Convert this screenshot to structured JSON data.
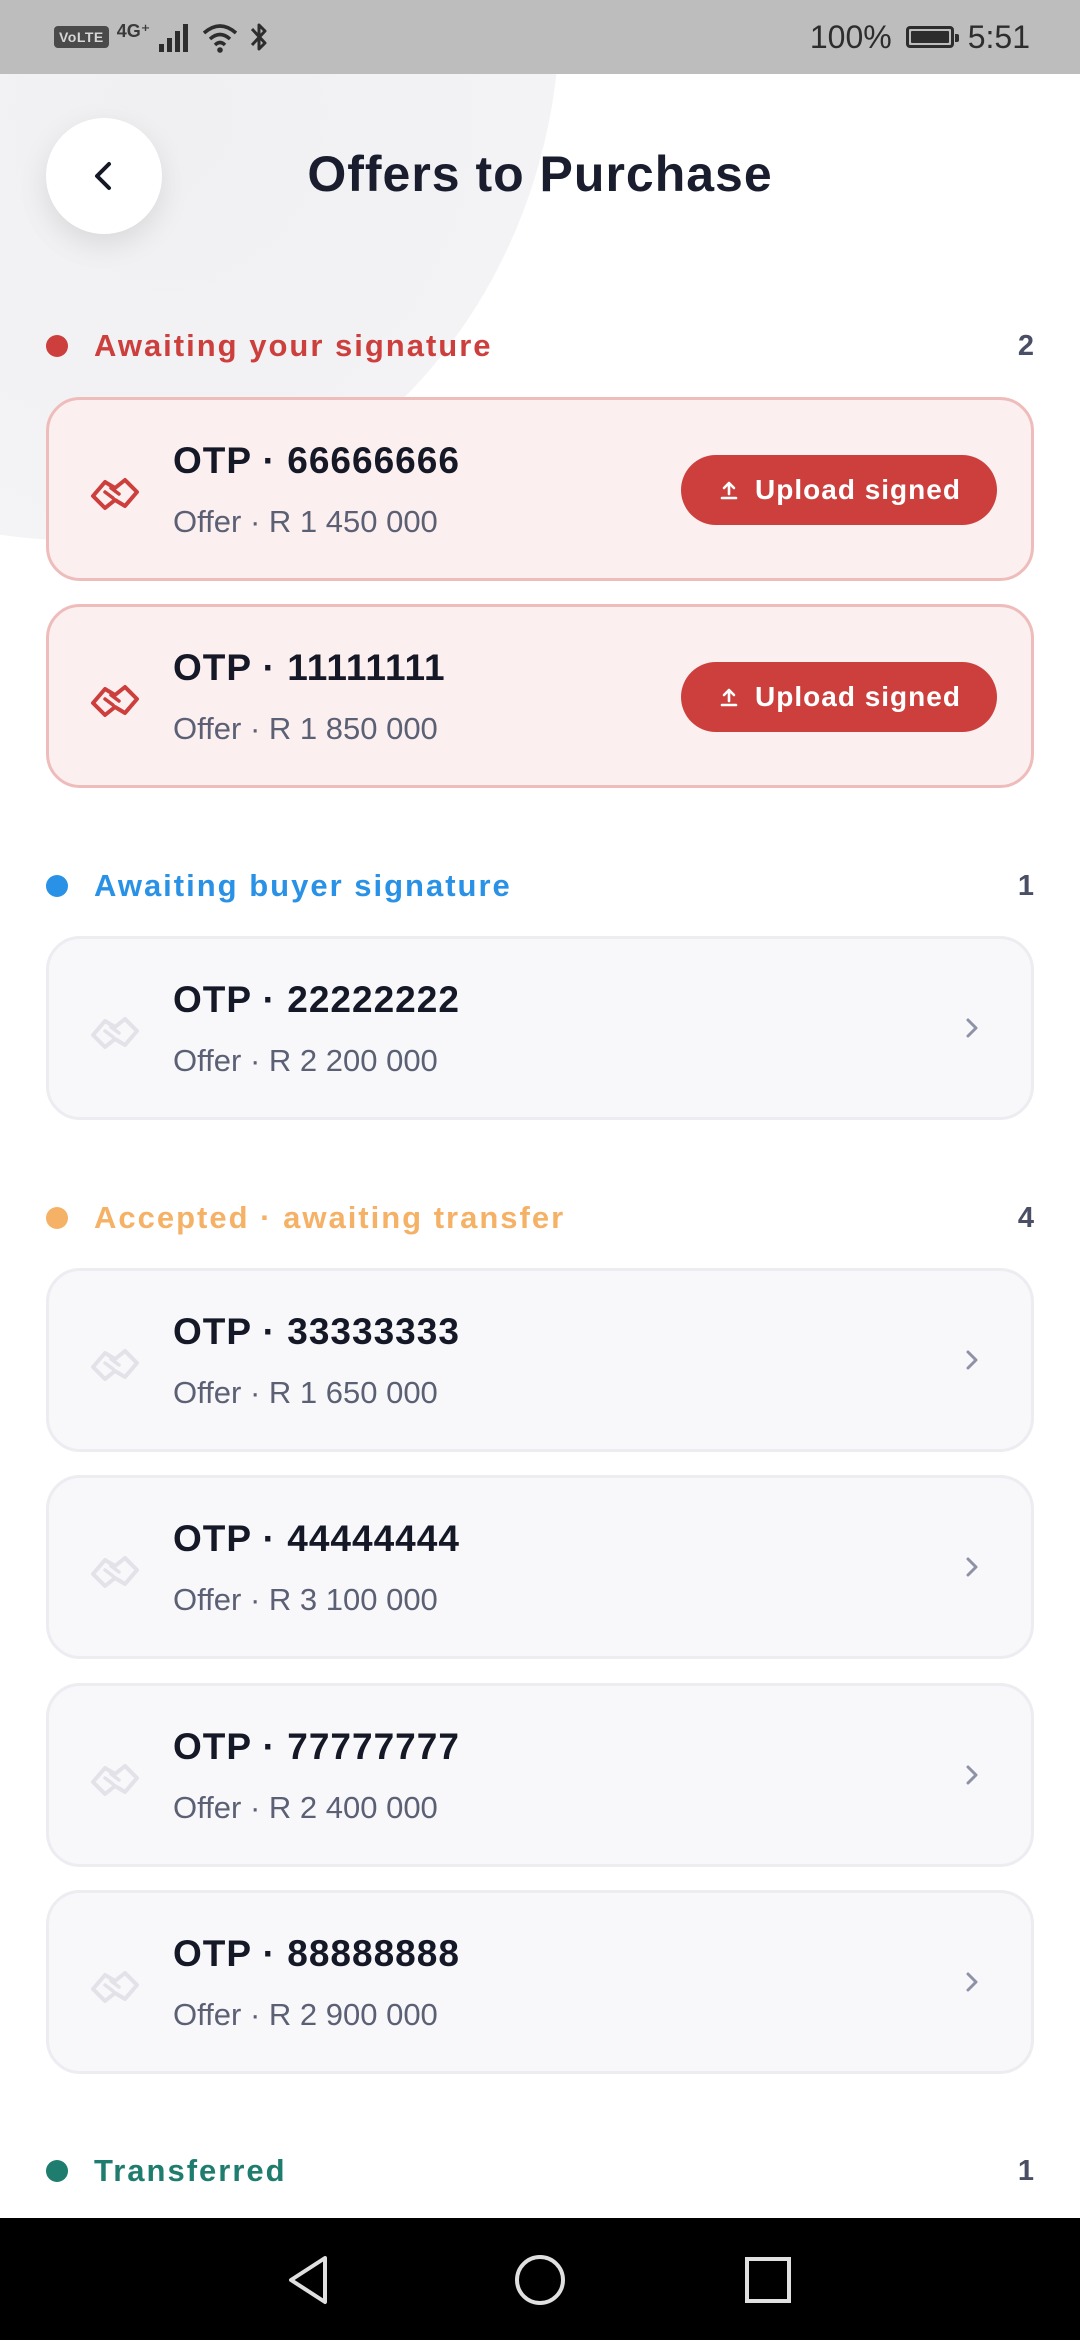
{
  "status_bar": {
    "volte": "VoLTE",
    "network": "4G⁺",
    "battery_text": "100%",
    "battery_level": 1.0,
    "time": "5:51"
  },
  "header": {
    "title": "Offers to Purchase"
  },
  "sections": [
    {
      "label": "Awaiting your signature",
      "count": "2",
      "color": "#cc3f3c",
      "items": [
        {
          "title": "OTP · 66666666",
          "sub": "Offer · R 1 450 000",
          "action": "Upload signed"
        },
        {
          "title": "OTP · 11111111",
          "sub": "Offer · R 1 850 000",
          "action": "Upload signed"
        }
      ]
    },
    {
      "label": "Awaiting buyer signature",
      "count": "1",
      "color": "#2a92e6",
      "items": [
        {
          "title": "OTP · 22222222",
          "sub": "Offer · R 2 200 000"
        }
      ]
    },
    {
      "label": "Accepted · awaiting transfer",
      "count": "4",
      "color": "#f5b266",
      "items": [
        {
          "title": "OTP · 33333333",
          "sub": "Offer · R 1 650 000"
        },
        {
          "title": "OTP · 44444444",
          "sub": "Offer · R 3 100 000"
        },
        {
          "title": "OTP · 77777777",
          "sub": "Offer · R 2 400 000"
        },
        {
          "title": "OTP · 88888888",
          "sub": "Offer · R 2 900 000"
        }
      ]
    },
    {
      "label": "Transferred",
      "count": "1",
      "color": "#1e7d6e",
      "items": []
    }
  ],
  "icons": {
    "back": "chevron-left-icon",
    "handshake": "handshake-icon",
    "upload": "upload-icon",
    "chevron": "chevron-right-icon",
    "nav_back": "triangle-back-icon",
    "nav_home": "circle-home-icon",
    "nav_recents": "square-recents-icon"
  }
}
